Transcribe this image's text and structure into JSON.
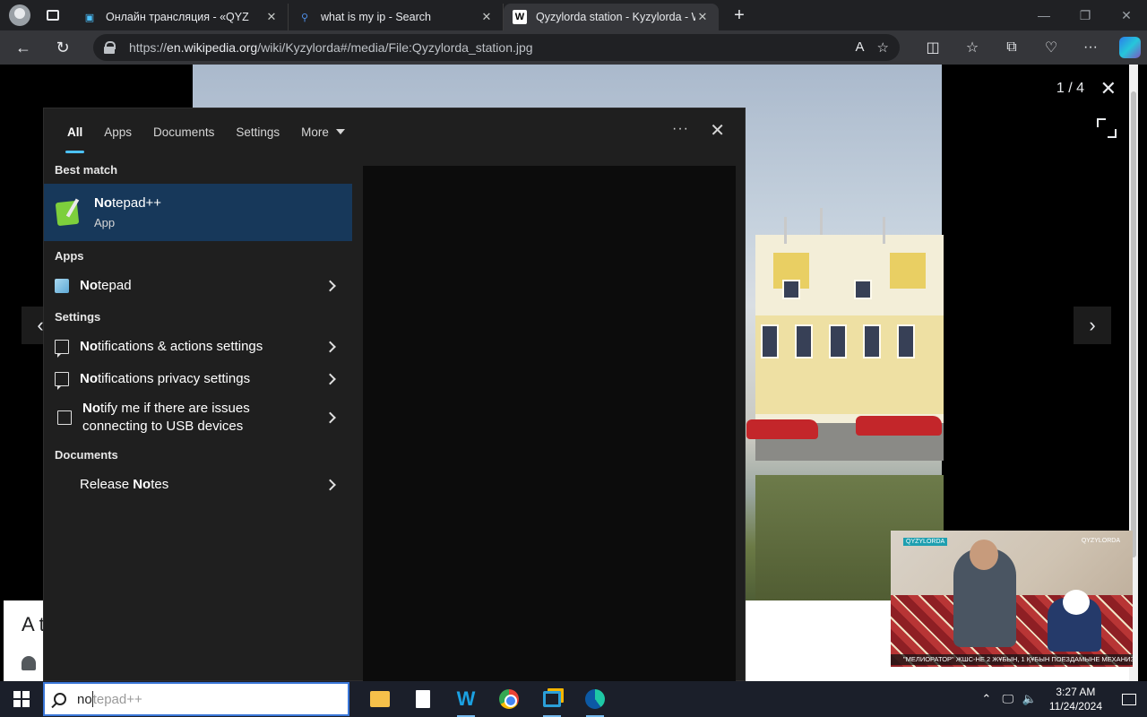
{
  "browser": {
    "tabs": [
      {
        "title": "Онлайн трансляция - «QYZ",
        "favicon": "tv-icon"
      },
      {
        "title": "what is my ip - Search",
        "favicon": "search-icon"
      },
      {
        "title": "Qyzylorda station - Kyzylorda - W",
        "favicon": "wikipedia-icon",
        "active": true
      }
    ],
    "url_prefix": "https://",
    "url_domain": "en.wikipedia.org",
    "url_path": "/wiki/Kyzylorda#/media/File:Qyzylorda_station.jpg"
  },
  "media_viewer": {
    "counter": "1 / 4",
    "caption_start": "A t"
  },
  "pip_video": {
    "logo_left": "QYZYLORDA",
    "logo_right": "QYZYLORDA",
    "ticker": "\"МЕЛИОРАТОР\" ЖШС-НЕ 2 ЖҰБЫН, 1 ҚҰБЫН ПОЕЗДАМЫНЕ МЕХАНИЗАТОР"
  },
  "search": {
    "tabs": [
      "All",
      "Apps",
      "Documents",
      "Settings",
      "More"
    ],
    "active_tab": "All",
    "best_match_heading": "Best match",
    "best_match": {
      "bold": "No",
      "rest": "tepad++",
      "subtitle": "App"
    },
    "apps_heading": "Apps",
    "apps": [
      {
        "bold": "No",
        "rest": "tepad"
      }
    ],
    "settings_heading": "Settings",
    "settings": [
      {
        "bold": "No",
        "rest": "tifications & actions settings"
      },
      {
        "bold": "No",
        "rest": "tifications privacy settings"
      },
      {
        "bold": "No",
        "rest": "tify me if there are issues connecting to USB devices"
      }
    ],
    "documents_heading": "Documents",
    "documents": [
      {
        "pre": "Release ",
        "bold": "No",
        "rest": "tes"
      }
    ],
    "query_typed": "no",
    "query_suggestion": "tepad++"
  },
  "taskbar": {
    "time": "3:27 AM",
    "date": "11/24/2024"
  }
}
